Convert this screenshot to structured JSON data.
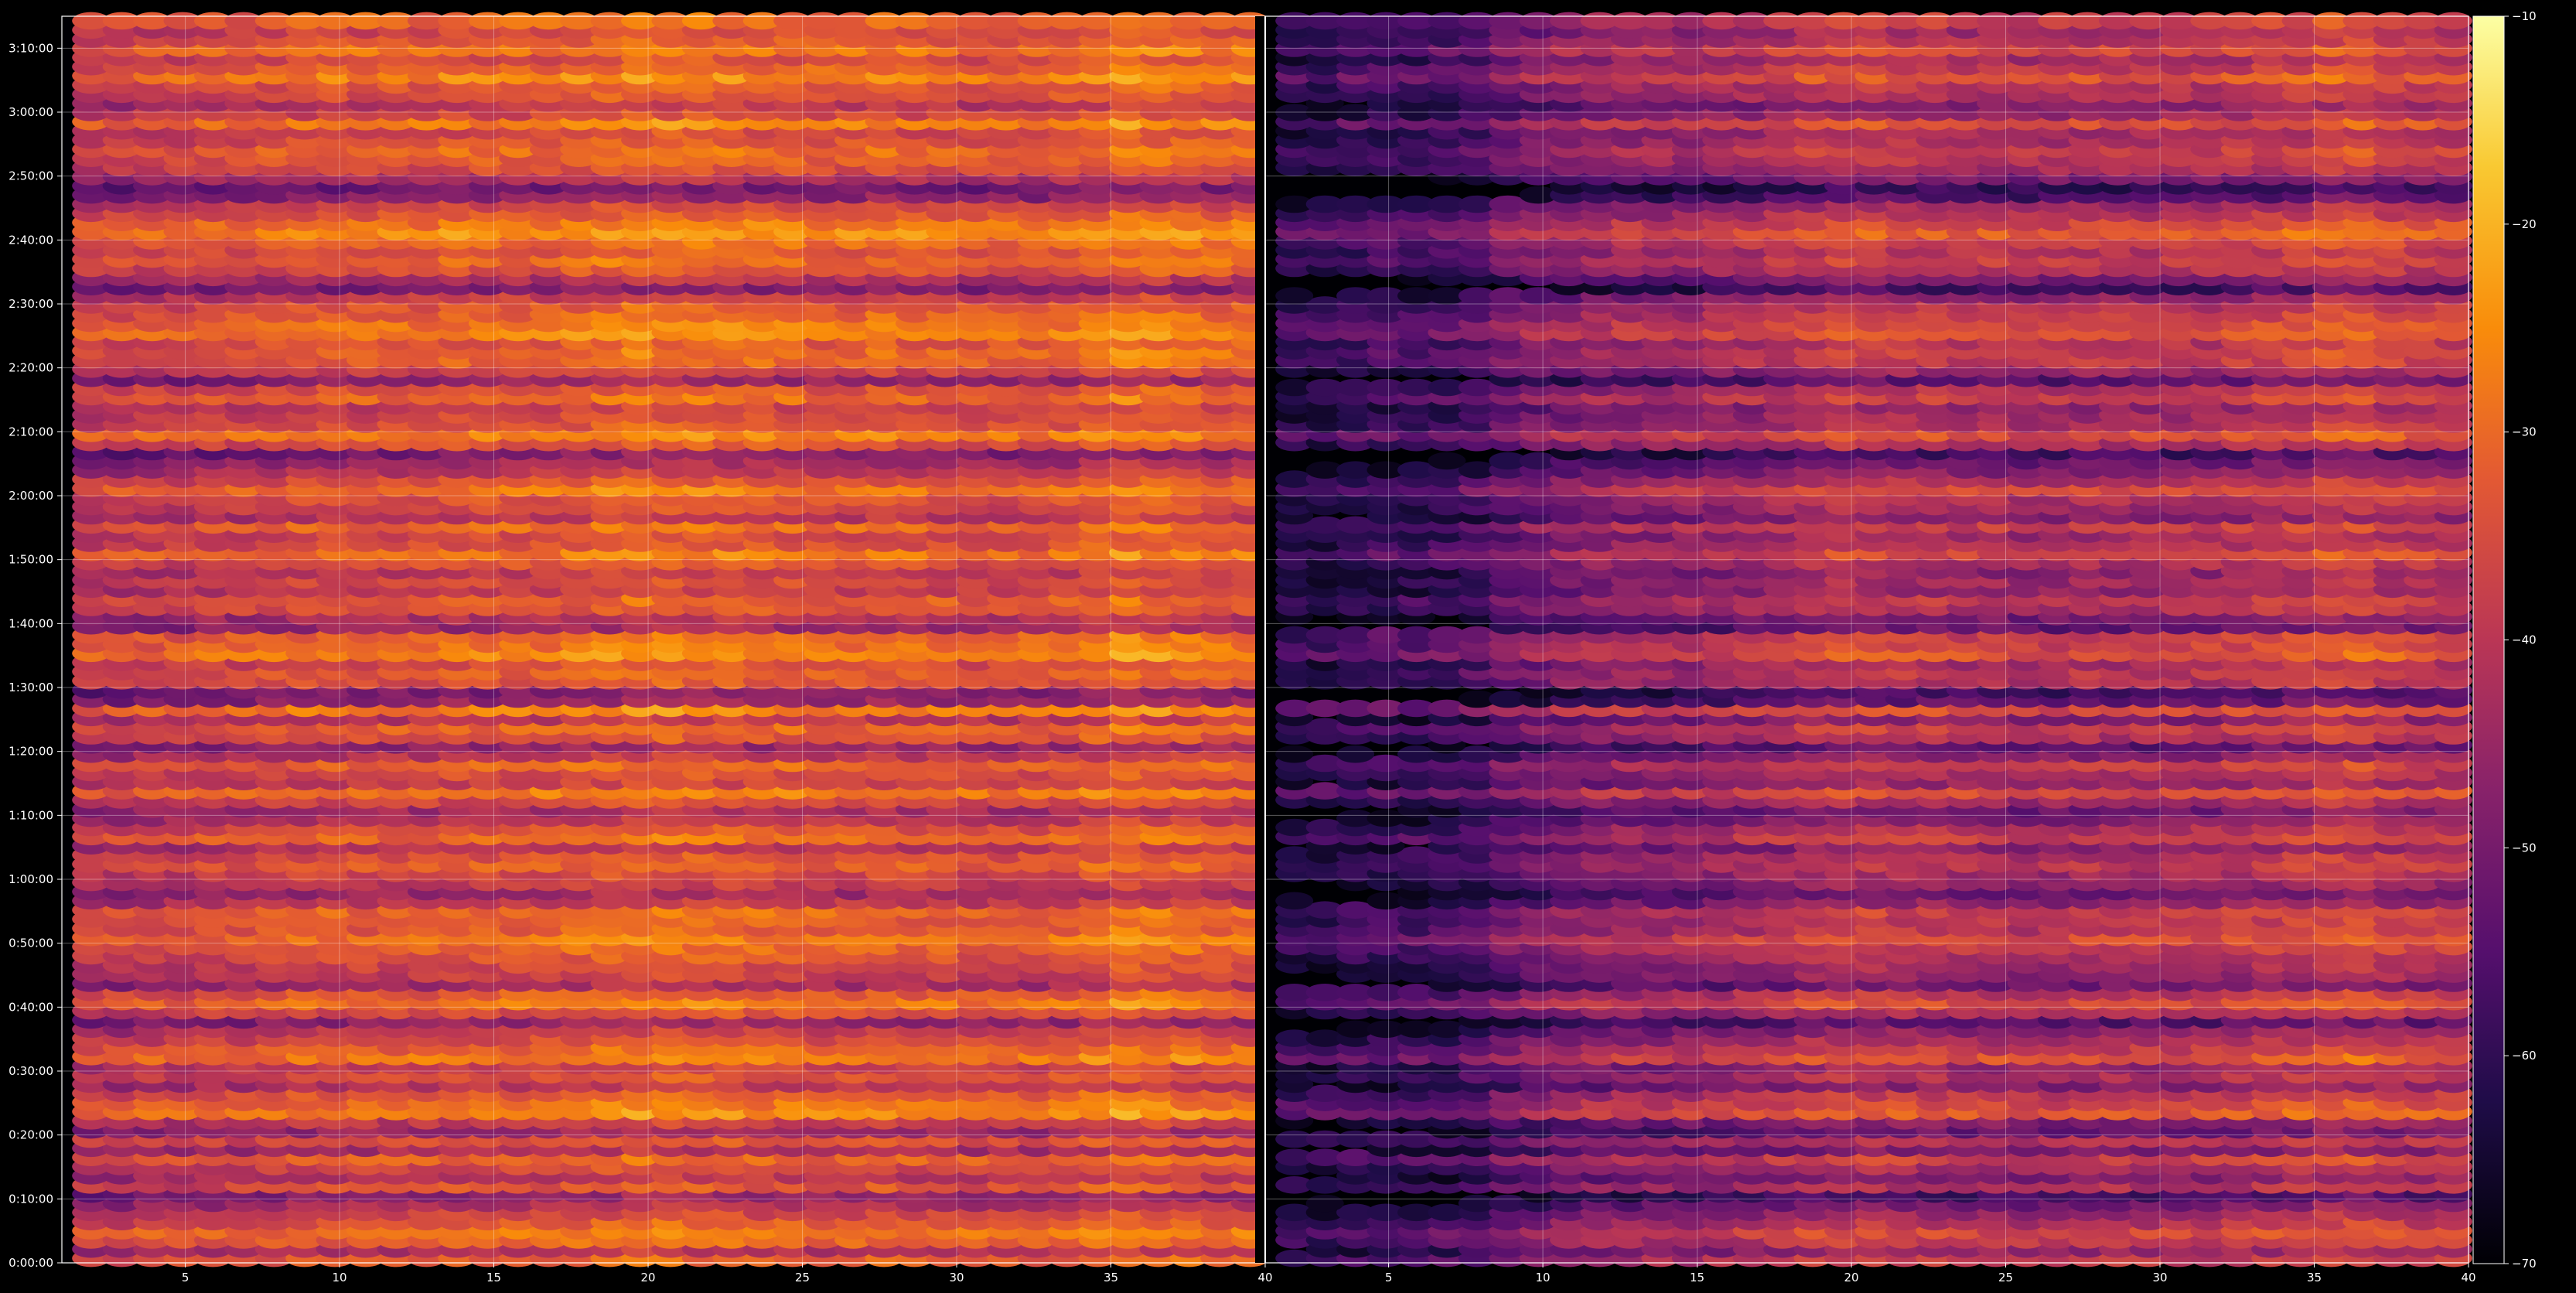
{
  "chart_data": {
    "type": "heatmap",
    "title": "",
    "xlabel": "",
    "ylabel": "",
    "colormap": "inferno",
    "background": "#000000",
    "grid": true,
    "grid_color": "#ffffff",
    "panels": [
      {
        "name": "",
        "xlim": [
          1,
          40
        ],
        "x_ticks": [
          5,
          10,
          15,
          20,
          25,
          30,
          35,
          40
        ],
        "x_tick_labels": [
          "5",
          "10",
          "15",
          "20",
          "25",
          "30",
          "35",
          "40"
        ]
      },
      {
        "name": "",
        "xlim": [
          1,
          40
        ],
        "x_ticks": [
          5,
          10,
          15,
          20,
          25,
          30,
          35,
          40
        ],
        "x_tick_labels": [
          "5",
          "10",
          "15",
          "20",
          "25",
          "30",
          "35",
          "40"
        ]
      }
    ],
    "columns_per_panel": 39,
    "ylim_seconds": [
      0,
      11700
    ],
    "y_tick_labels": [
      "0:00:00",
      "0:10:00",
      "0:20:00",
      "0:30:00",
      "0:40:00",
      "0:50:00",
      "1:00:00",
      "1:10:00",
      "1:20:00",
      "1:30:00",
      "1:40:00",
      "1:50:00",
      "2:00:00",
      "2:10:00",
      "2:20:00",
      "2:30:00",
      "2:40:00",
      "2:50:00",
      "3:00:00",
      "3:10:00"
    ],
    "colorbar": {
      "range": [
        -70,
        -10
      ],
      "ticks": [
        -10,
        -20,
        -30,
        -40,
        -50,
        -60,
        -70
      ],
      "tick_labels": [
        "−10",
        "−20",
        "−30",
        "−40",
        "−50",
        "−60",
        "−70"
      ]
    },
    "row_profile_right": [
      -41,
      -48,
      -41,
      -38,
      -43,
      -47,
      -52,
      -60,
      -44,
      -50,
      -46,
      -40,
      -52,
      -44,
      -55,
      -50,
      -35,
      -38,
      -42,
      -50,
      -44,
      -48,
      -36,
      -41,
      -45,
      -49,
      -57,
      -45,
      -37,
      -42,
      -53,
      -48,
      -46,
      -44,
      -41,
      -37,
      -42,
      -42,
      -40,
      -49,
      -54,
      -49,
      -46,
      -42,
      -44,
      -50,
      -40,
      -44,
      -50,
      -53,
      -46,
      -37,
      -48,
      -45,
      -41,
      -50,
      -56,
      -44,
      -41,
      -50,
      -37,
      -56,
      -60,
      -44,
      -42,
      -45,
      -36,
      -39,
      -40,
      -55,
      -52,
      -44,
      -42,
      -48,
      -46,
      -49,
      -44,
      -38,
      -44,
      -46,
      -40,
      -50,
      -46,
      -44,
      -38,
      -44,
      -50,
      -54,
      -60,
      -44,
      -37,
      -44,
      -46,
      -48,
      -40,
      -44,
      -56,
      -47,
      -41,
      -40,
      -43,
      -36,
      -38,
      -41,
      -43,
      -48,
      -60,
      -52,
      -44,
      -40,
      -43,
      -40,
      -34,
      -38,
      -43,
      -47,
      -58,
      -62,
      -52,
      -45,
      -42,
      -40,
      -44,
      -46,
      -37,
      -46,
      -50,
      -44,
      -43,
      -36,
      -41,
      -45,
      -38,
      -43,
      -46,
      -40
    ],
    "row_profile_left": [
      -35,
      -44,
      -34,
      -31,
      -36,
      -40,
      -45,
      -50,
      -37,
      -43,
      -39,
      -34,
      -45,
      -37,
      -48,
      -42,
      -29,
      -32,
      -35,
      -43,
      -37,
      -41,
      -30,
      -34,
      -38,
      -42,
      -49,
      -38,
      -31,
      -35,
      -46,
      -41,
      -39,
      -37,
      -34,
      -31,
      -35,
      -35,
      -33,
      -42,
      -47,
      -42,
      -39,
      -35,
      -37,
      -43,
      -33,
      -37,
      -43,
      -46,
      -39,
      -30,
      -41,
      -38,
      -34,
      -43,
      -49,
      -37,
      -34,
      -43,
      -30,
      -49,
      -52,
      -37,
      -35,
      -38,
      -29,
      -32,
      -33,
      -48,
      -45,
      -37,
      -35,
      -41,
      -39,
      -42,
      -37,
      -31,
      -37,
      -39,
      -33,
      -43,
      -39,
      -37,
      -31,
      -37,
      -43,
      -47,
      -52,
      -37,
      -30,
      -37,
      -39,
      -41,
      -33,
      -37,
      -49,
      -40,
      -34,
      -33,
      -36,
      -29,
      -31,
      -34,
      -36,
      -41,
      -52,
      -45,
      -37,
      -33,
      -36,
      -33,
      -27,
      -31,
      -36,
      -40,
      -50,
      -54,
      -45,
      -38,
      -35,
      -33,
      -37,
      -39,
      -30,
      -39,
      -43,
      -37,
      -36,
      -29,
      -34,
      -38,
      -31,
      -36,
      -39,
      -33
    ],
    "column_profile_left": [
      -2,
      -2,
      -1,
      -1,
      0,
      0,
      1,
      2,
      2,
      2,
      2,
      2,
      3,
      3,
      3,
      3,
      4,
      5,
      6,
      6,
      5,
      5,
      4,
      4,
      3,
      3,
      4,
      3,
      3,
      2,
      2,
      2,
      3,
      5,
      7,
      6,
      5,
      4,
      4
    ],
    "column_profile_right": [
      -18,
      -18,
      -16,
      -15,
      -15,
      -14,
      -12,
      -8,
      -6,
      -4,
      -3,
      -2,
      -2,
      -2,
      -1,
      0,
      1,
      3,
      4,
      4,
      3,
      3,
      2,
      2,
      1,
      1,
      2,
      2,
      2,
      2,
      2,
      3,
      4,
      5,
      7,
      7,
      5,
      4,
      4
    ]
  }
}
